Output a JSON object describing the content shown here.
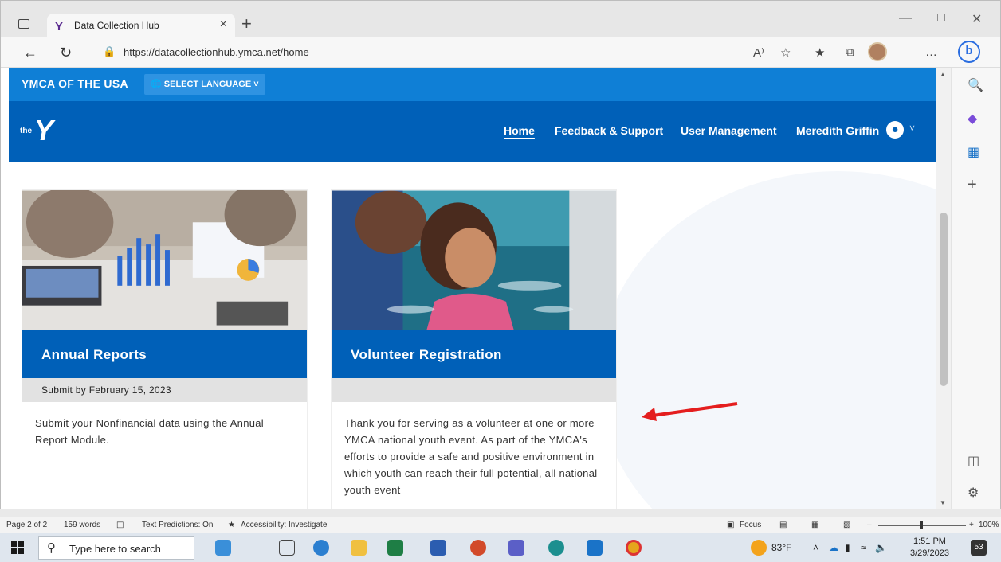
{
  "browser": {
    "tab_title": "Data Collection Hub",
    "tab_close": "×",
    "new_tab": "+",
    "url": "https://datacollectionhub.ymca.net/home",
    "read_aloud": "A⁾"
  },
  "site": {
    "org_name": "YMCA OF THE USA",
    "language_button": "SELECT LANGUAGE",
    "logo_the": "the",
    "logo_y": "Y",
    "nav": {
      "home": "Home",
      "feedback": "Feedback & Support",
      "user_mgmt": "User Management",
      "user_name": "Meredith Griffin"
    }
  },
  "cards": [
    {
      "title": "Annual Reports",
      "subtitle": "Submit by February 15, 2023",
      "body": "Submit your Nonfinancial data using the Annual Report Module."
    },
    {
      "title": "Volunteer Registration",
      "subtitle": "",
      "body": "Thank you for serving as a volunteer at one or more YMCA national youth event. As part of the YMCA's efforts to provide a safe and positive environment in which youth can reach their full potential, all national youth event"
    }
  ],
  "statusbar": {
    "page": "Page 2 of 2",
    "words": "159 words",
    "text_predictions": "Text Predictions: On",
    "accessibility": "Accessibility: Investigate",
    "focus": "Focus",
    "zoom": "100%"
  },
  "taskbar": {
    "search_placeholder": "Type here to search",
    "weather": "83°F",
    "time": "1:51 PM",
    "date": "3/29/2023",
    "notifications": "53"
  },
  "colors": {
    "topstrip": "#0f7fd6",
    "navbar": "#0060b8",
    "arrow": "#e41e1e"
  }
}
